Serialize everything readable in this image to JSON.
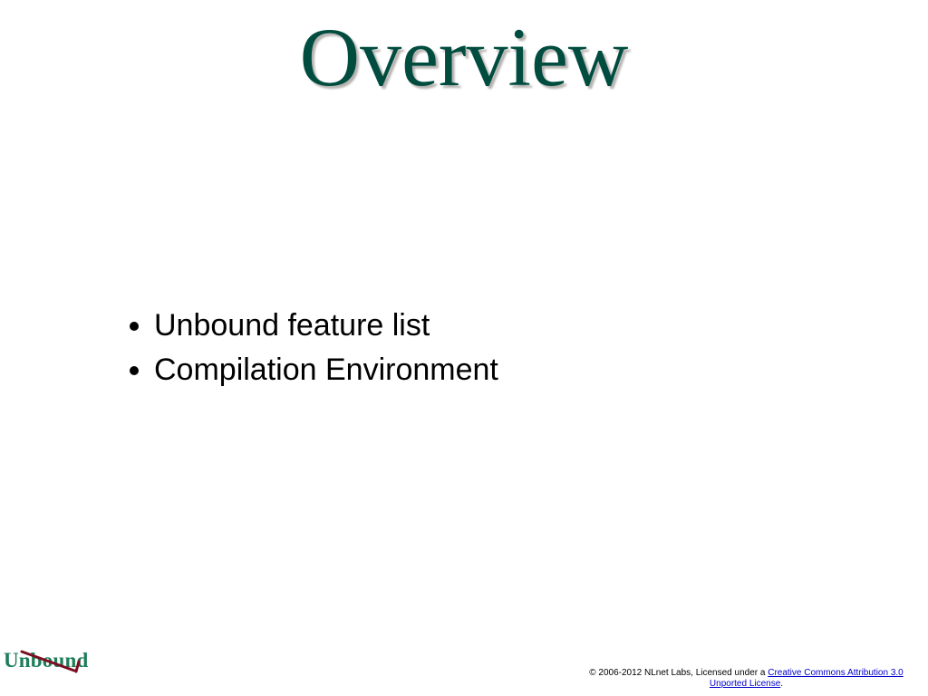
{
  "title": "Overview",
  "bullets": [
    "Unbound feature list",
    "Compilation Environment"
  ],
  "logo": {
    "text": "Unbound"
  },
  "footer": {
    "copyright_prefix": "© 2006-2012 NLnet Labs, Licensed under a ",
    "license_link_text": "Creative Commons Attribution 3.0 Unported License",
    "period": "."
  },
  "colors": {
    "title_color": "#004d40",
    "title_shadow": "#b5b2af",
    "logo_color": "#1e7d5a",
    "strike_color": "#7a0e20"
  }
}
